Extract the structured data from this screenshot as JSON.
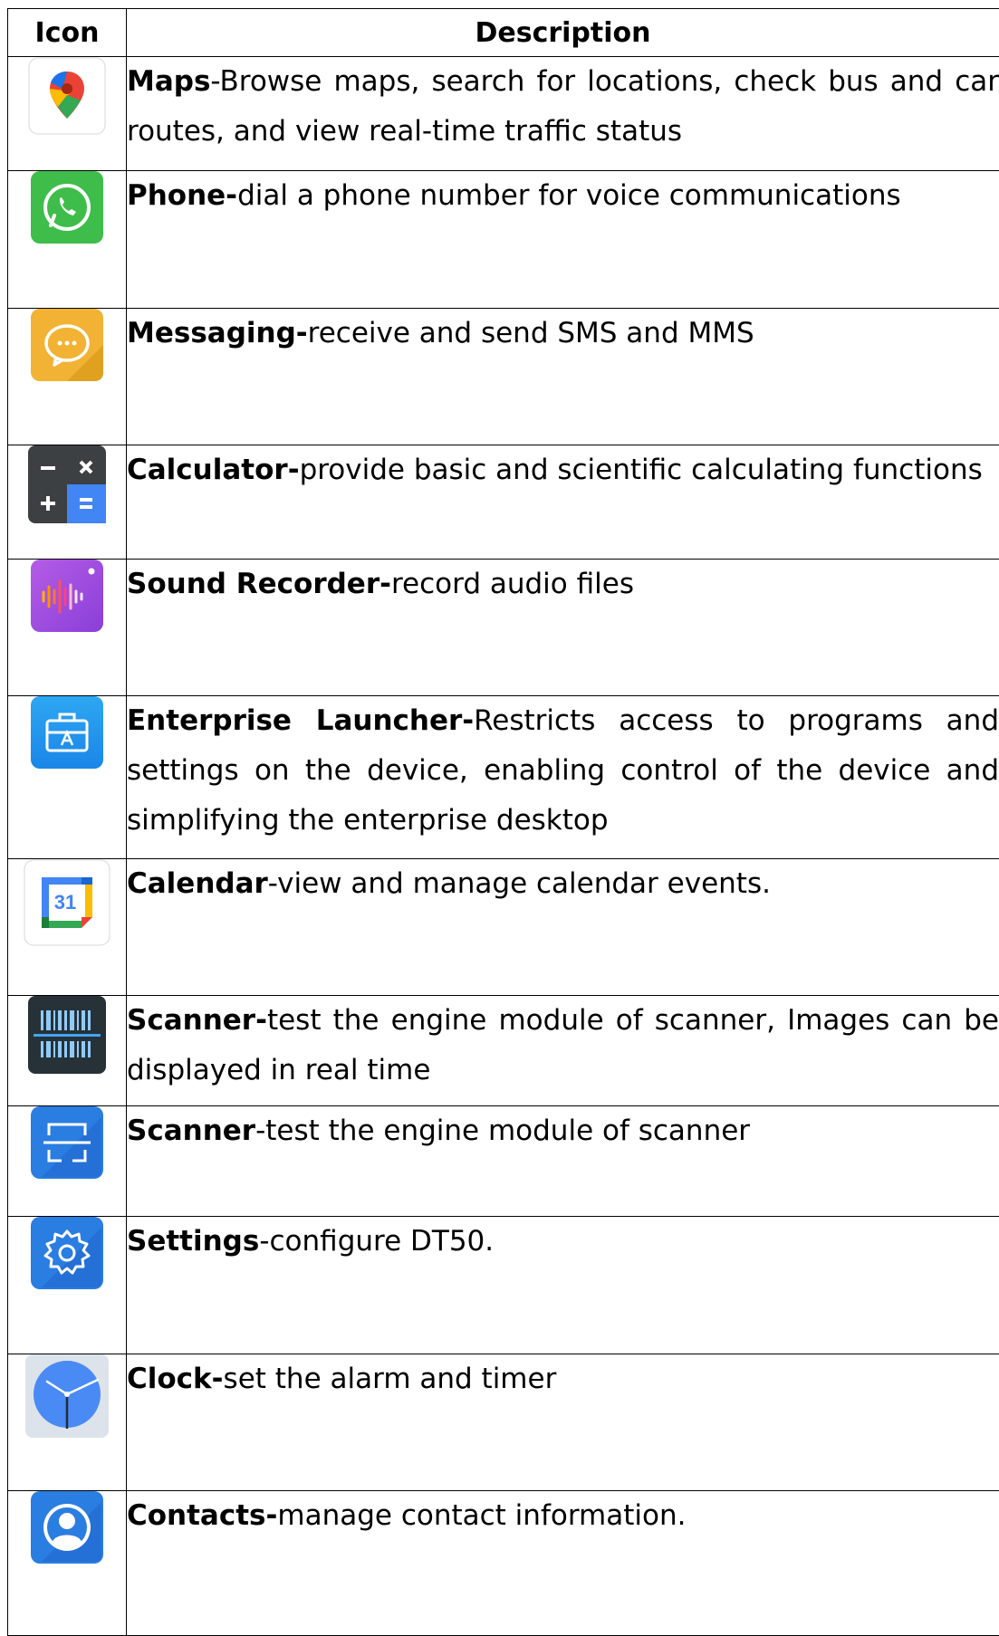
{
  "table": {
    "headers": {
      "icon": "Icon",
      "description": "Description"
    },
    "rows": [
      {
        "name": "Maps",
        "desc": "-Browse maps, search for locations, check bus and car routes, and view real-time traffic status",
        "icon": "maps-icon"
      },
      {
        "name": "Phone-",
        "desc": "dial a phone number for voice communications",
        "icon": "phone-icon"
      },
      {
        "name": "Messaging-",
        "desc": "receive and send SMS and MMS",
        "icon": "messaging-icon"
      },
      {
        "name": "Calculator-",
        "desc": "provide basic and scientific calculating functions",
        "icon": "calculator-icon"
      },
      {
        "name": "Sound Recorder-",
        "desc": "record audio files",
        "icon": "sound-recorder-icon"
      },
      {
        "name": "Enterprise Launcher-",
        "desc": "Restricts access to programs and settings on the device, enabling control of the device and simplifying the enterprise desktop",
        "icon": "enterprise-launcher-icon"
      },
      {
        "name": "Calendar",
        "desc": "-view and manage calendar events.",
        "icon": "calendar-icon",
        "icon_text": "31"
      },
      {
        "name": "Scanner-",
        "desc": "test the engine module of scanner, Images can be displayed in real time",
        "icon": "barcode-scanner-icon"
      },
      {
        "name": "Scanner",
        "desc": "-test the engine module of scanner",
        "icon": "scanner-frame-icon"
      },
      {
        "name": "Settings",
        "desc": "-configure DT50.",
        "icon": "gear-icon"
      },
      {
        "name": "Clock-",
        "desc": "set the alarm and timer",
        "icon": "clock-icon"
      },
      {
        "name": "Contacts-",
        "desc": "manage contact information.",
        "icon": "contacts-icon"
      }
    ]
  }
}
